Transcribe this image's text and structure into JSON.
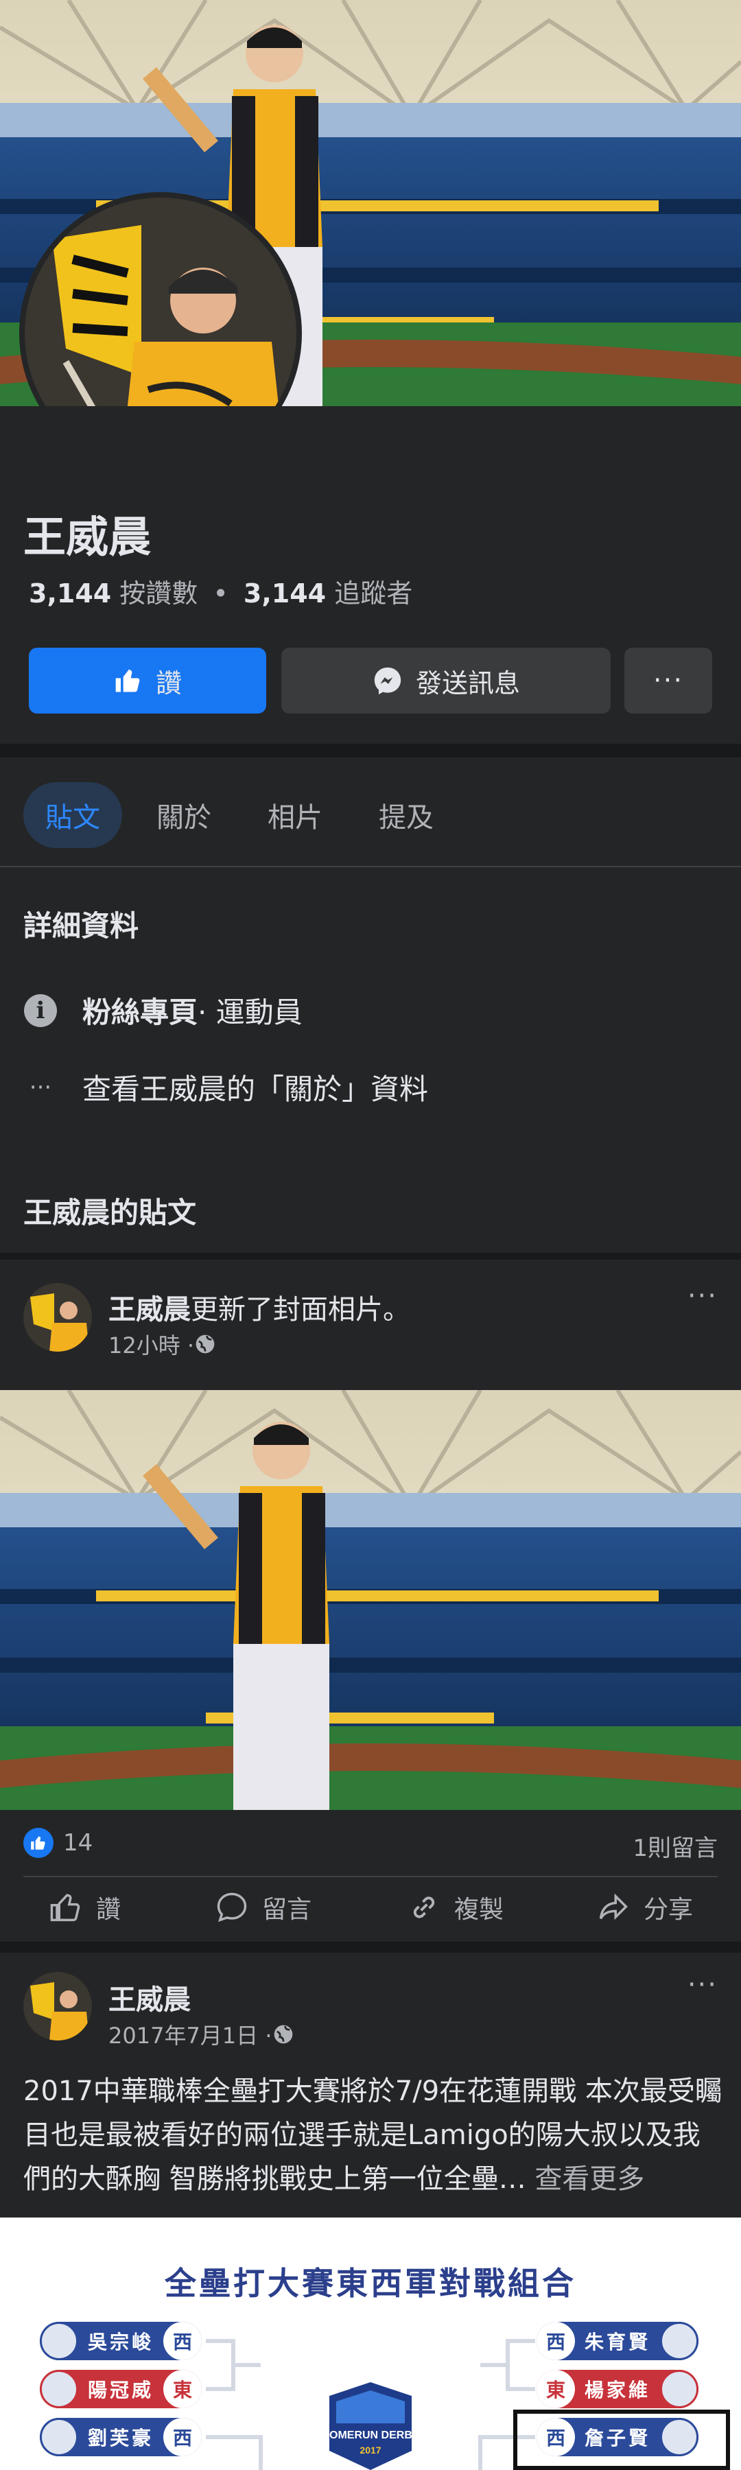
{
  "profile": {
    "name": "王威晨",
    "likes_count": "3,144",
    "likes_label": "按讚數",
    "dot": "•",
    "followers_count": "3,144",
    "followers_label": "追蹤者"
  },
  "buttons": {
    "like": "讚",
    "message": "發送訊息",
    "more": "···"
  },
  "tabs": [
    "貼文",
    "關於",
    "相片",
    "提及"
  ],
  "details": {
    "title": "詳細資料",
    "category_strong": "粉絲專頁",
    "category_rest": " · 運動員",
    "about_link": "查看王威晨的「關於」資料"
  },
  "posts_title": "王威晨的貼文",
  "post1": {
    "author": "王威晨",
    "action": "更新了封面相片。",
    "time": "12小時 · ",
    "reactions": "14",
    "comments": "1則留言",
    "actions": [
      "讚",
      "留言",
      "複製",
      "分享"
    ]
  },
  "post2": {
    "author": "王威晨",
    "time": "2017年7月1日 · ",
    "text": "2017中華職棒全壘打大賽將於7/9在花蓮開戰 本次最受矚目也是最被看好的兩位選手就是Lamigo的陽大叔以及我們的大酥胸 智勝將挑戰史上第一位全壘…",
    "see_more": " 查看更多"
  },
  "graphic": {
    "title": "全壘打大賽東西軍對戰組合",
    "left": [
      {
        "name": "吳宗峻",
        "team": "西"
      },
      {
        "name": "陽冠威",
        "team": "東"
      },
      {
        "name": "劉芙豪",
        "team": "西"
      }
    ],
    "right": [
      {
        "name": "朱育賢",
        "team": "西"
      },
      {
        "name": "楊家維",
        "team": "東"
      },
      {
        "name": "詹子賢",
        "team": "西"
      }
    ],
    "logo_text": "HOMERUN DERBY",
    "logo_year": "2017"
  },
  "colors": {
    "background": "#18191a",
    "card": "#242526",
    "accent": "#1877f2",
    "jersey": "#f2b01e"
  }
}
